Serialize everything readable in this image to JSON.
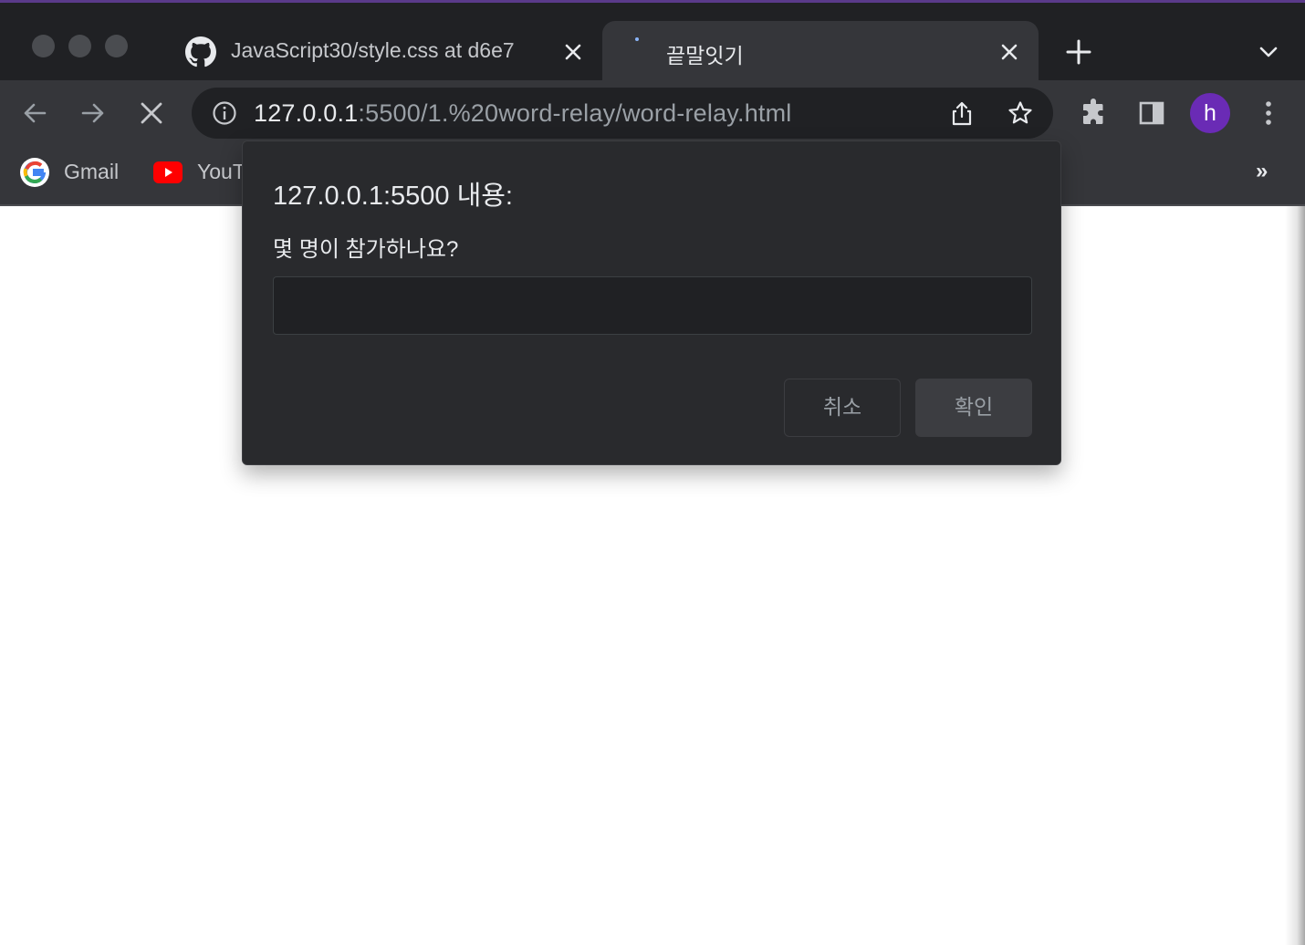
{
  "browser": {
    "tabs": [
      {
        "title": "JavaScript30/style.css at d6e7",
        "favicon": "github-icon",
        "active": false
      },
      {
        "title": "끝말잇기",
        "favicon": "loading-spinner-icon",
        "active": true
      }
    ],
    "url": {
      "host": "127.0.0.1",
      "rest": ":5500/1.%20word-relay/word-relay.html"
    },
    "profile_initial": "h",
    "profile_color": "#6a2bb5",
    "bookmarks": [
      {
        "label": "Gmail",
        "icon": "google-icon"
      },
      {
        "label": "YouT",
        "icon": "youtube-icon"
      }
    ],
    "bookmarks_overflow": "»"
  },
  "dialog": {
    "title": "127.0.0.1:5500 내용:",
    "message": "몇 명이 참가하나요?",
    "input_value": "",
    "cancel_label": "취소",
    "ok_label": "확인"
  },
  "colors": {
    "tabstrip": "#202124",
    "toolbar": "#35363a",
    "dialog_bg": "#292a2d",
    "accent_spinner": "#8ab4f8"
  }
}
